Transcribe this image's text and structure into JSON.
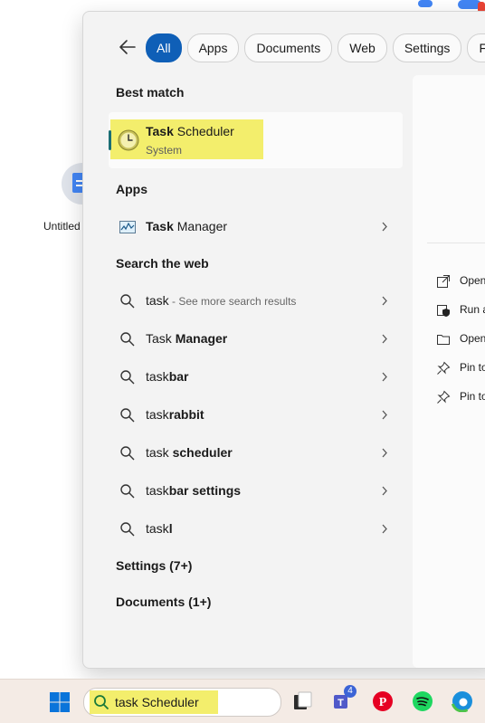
{
  "desktop": {
    "icon_label": "Untitled"
  },
  "filters": {
    "back_icon": "back-arrow-icon",
    "chips": [
      {
        "label": "All",
        "active": true
      },
      {
        "label": "Apps",
        "active": false
      },
      {
        "label": "Documents",
        "active": false
      },
      {
        "label": "Web",
        "active": false
      },
      {
        "label": "Settings",
        "active": false
      },
      {
        "label": "Folders",
        "active": false
      }
    ]
  },
  "best_match": {
    "heading": "Best match",
    "title_bold": "Task",
    "title_rest": " Scheduler",
    "subtitle": "System",
    "icon": "clock-icon"
  },
  "apps": {
    "heading": "Apps",
    "items": [
      {
        "bold": "Task",
        "rest": " Manager",
        "icon": "task-manager-icon"
      }
    ]
  },
  "web": {
    "heading": "Search the web",
    "items": [
      {
        "plain": "task",
        "bold": "",
        "note": " - See more search results"
      },
      {
        "plain": "Task ",
        "bold": "Manager",
        "note": ""
      },
      {
        "plain": "task",
        "bold": "bar",
        "note": ""
      },
      {
        "plain": "task",
        "bold": "rabbit",
        "note": ""
      },
      {
        "plain": "task ",
        "bold": "scheduler",
        "note": ""
      },
      {
        "plain": "task",
        "bold": "bar settings",
        "note": ""
      },
      {
        "plain": "task",
        "bold": "l",
        "note": ""
      }
    ]
  },
  "settings_heading": "Settings (7+)",
  "documents_heading": "Documents (1+)",
  "actions": [
    {
      "label": "Open",
      "icon": "open-external-icon"
    },
    {
      "label": "Run as administrator",
      "icon": "shield-icon"
    },
    {
      "label": "Open file location",
      "icon": "folder-icon"
    },
    {
      "label": "Pin to Start",
      "icon": "pin-icon"
    },
    {
      "label": "Pin to taskbar",
      "icon": "pin-icon"
    }
  ],
  "taskbar": {
    "search_value": "task Scheduler",
    "teams_badge": "4",
    "colors": {
      "accent": "#0f5fb7",
      "highlight": "#f3ee6c",
      "start_blue": "#0a74da",
      "pinterest": "#e60023",
      "spotify": "#1ed760"
    }
  }
}
